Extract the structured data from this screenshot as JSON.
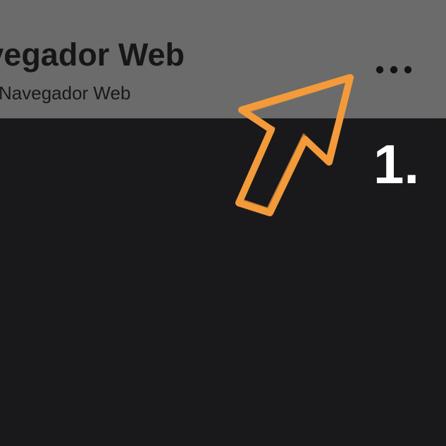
{
  "header": {
    "title": "Navegador Web",
    "subtitle": "Navegador Web",
    "more_icon": "more-horizontal-icon"
  },
  "annotation": {
    "arrow_icon": "arrow-up-right-icon",
    "arrow_color": "#f39a3a",
    "step_label": "1."
  },
  "colors": {
    "header_bg": "#6b6b6b",
    "content_bg": "#19191b",
    "title_text": "#161616",
    "step_text": "#ffffff"
  }
}
